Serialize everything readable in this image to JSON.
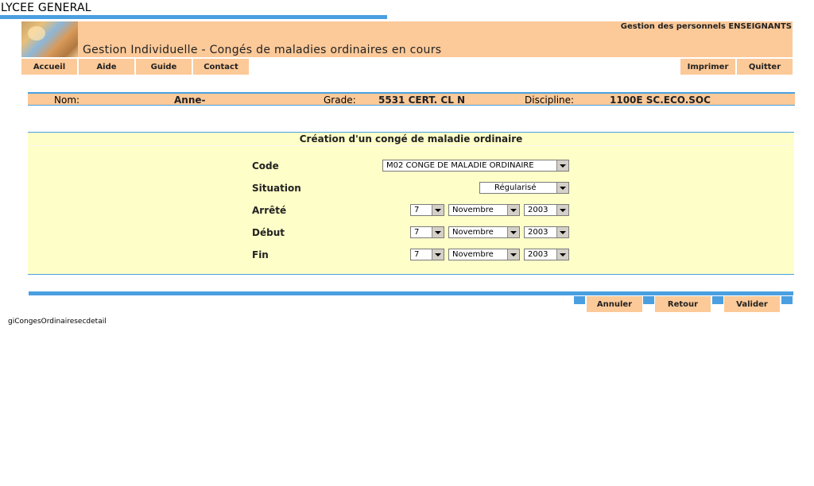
{
  "establishment": "LYCEE GENERAL",
  "header": {
    "app_title": "Gestion des personnels ENSEIGNANTS",
    "page_title": "Gestion Individuelle - Congés de maladies ordinaires en cours"
  },
  "nav_left": [
    "Accueil",
    "Aide",
    "Guide",
    "Contact"
  ],
  "nav_right": [
    "Imprimer",
    "Quitter"
  ],
  "person": {
    "nom_label": "Nom:",
    "nom_value": "Anne-",
    "grade_label": "Grade:",
    "grade_value": "5531 CERT. CL N",
    "discipline_label": "Discipline:",
    "discipline_value": "1100E SC.ECO.SOC"
  },
  "form": {
    "title": "Création d'un congé de maladie ordinaire",
    "code_label": "Code",
    "code_value": "M02 CONGE DE MALADIE ORDINAIRE",
    "situation_label": "Situation",
    "situation_value": "Régularisé",
    "arrete_label": "Arrêté",
    "arrete": {
      "day": "7",
      "month": "Novembre",
      "year": "2003"
    },
    "debut_label": "Début",
    "debut": {
      "day": "7",
      "month": "Novembre",
      "year": "2003"
    },
    "fin_label": "Fin",
    "fin": {
      "day": "7",
      "month": "Novembre",
      "year": "2003"
    }
  },
  "actions": [
    "Annuler",
    "Retour",
    "Valider"
  ],
  "footer_id": "giCongesOrdinairesecdetail"
}
